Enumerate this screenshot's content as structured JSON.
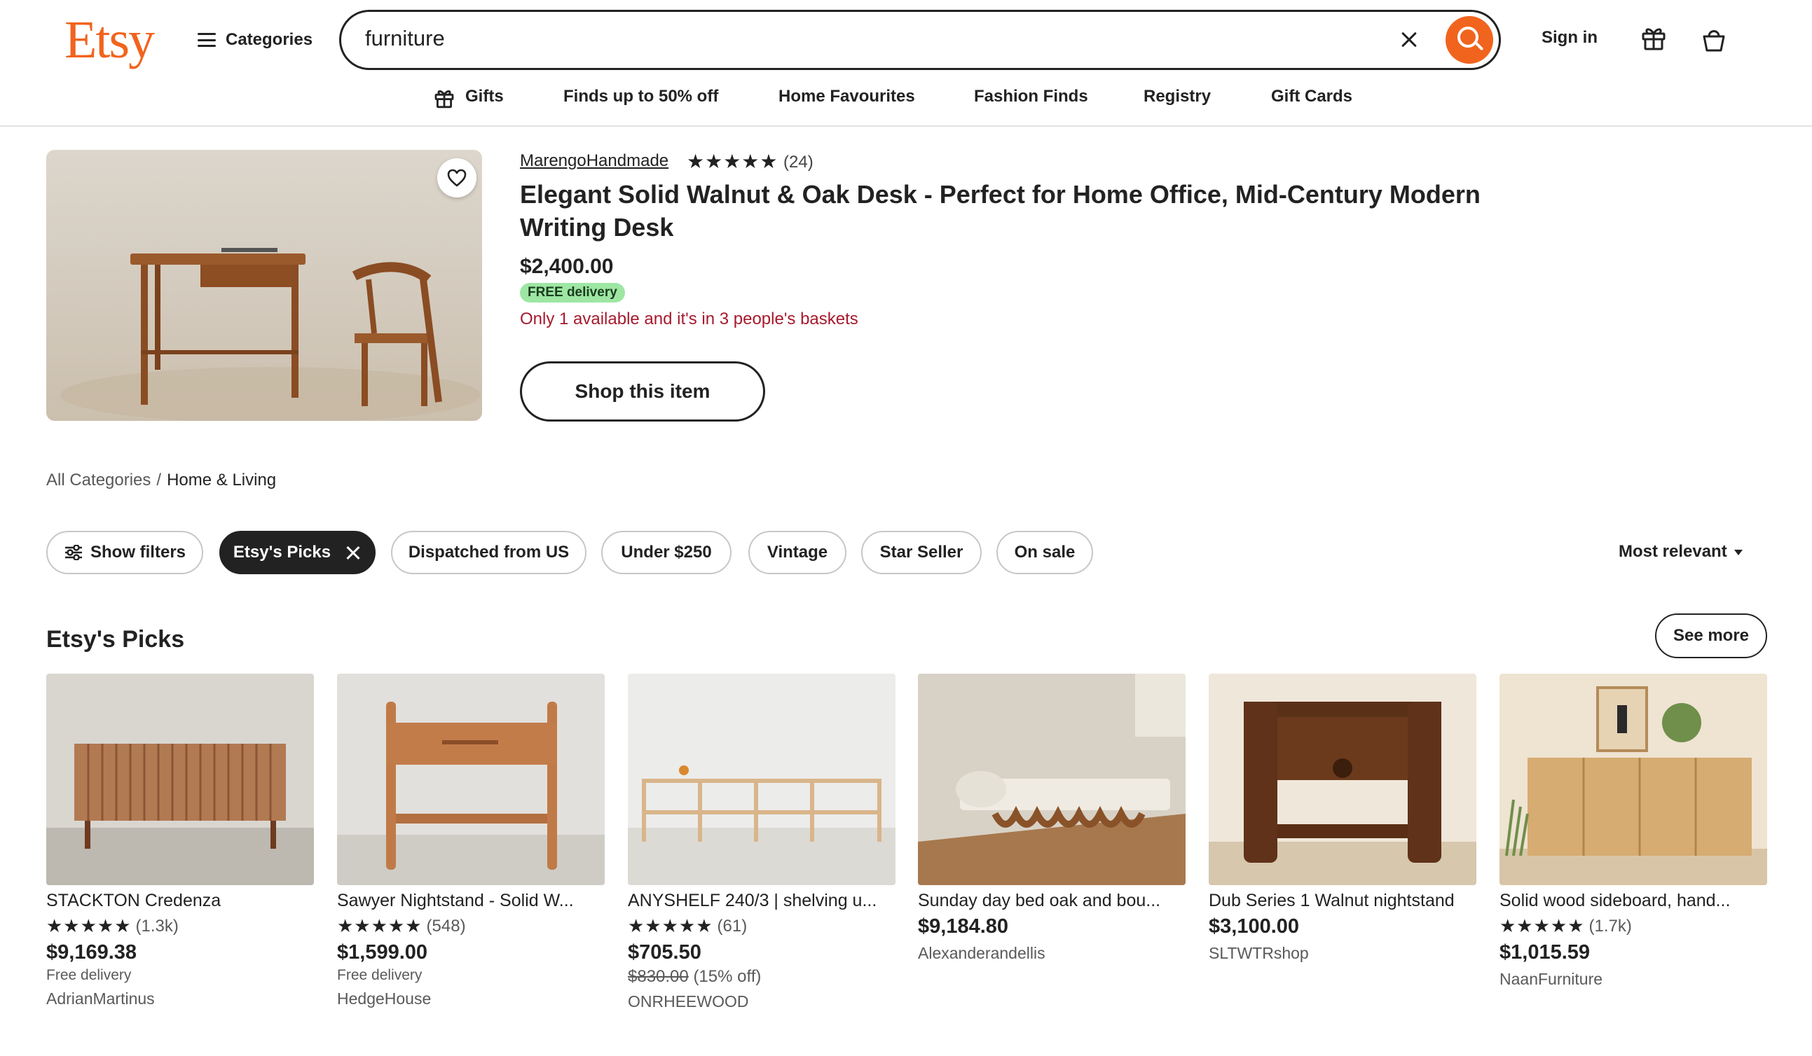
{
  "header": {
    "logo": "Etsy",
    "categories_label": "Categories",
    "search_value": "furniture",
    "signin_label": "Sign in"
  },
  "nav": [
    {
      "label": "Gifts"
    },
    {
      "label": "Finds up to 50% off"
    },
    {
      "label": "Home Favourites"
    },
    {
      "label": "Fashion Finds"
    },
    {
      "label": "Registry"
    },
    {
      "label": "Gift Cards"
    }
  ],
  "featured": {
    "shop": "MarengoHandmade",
    "stars": "★★★★★",
    "review_count": "(24)",
    "title": "Elegant Solid Walnut & Oak Desk - Perfect for Home Office, Mid-Century Modern Writing Desk",
    "price": "$2,400.00",
    "badge": "FREE delivery",
    "availability": "Only 1 available and it's in 3 people's baskets",
    "cta": "Shop this item"
  },
  "breadcrumb": {
    "root": "All Categories",
    "separator": "/",
    "current": "Home & Living"
  },
  "filters": {
    "show_filters": "Show filters",
    "chips": [
      "Etsy's Picks",
      "Dispatched from US",
      "Under $250",
      "Vintage",
      "Star Seller",
      "On sale"
    ],
    "sort": "Most relevant"
  },
  "picks": {
    "title": "Etsy's Picks",
    "see_more": "See more",
    "items": [
      {
        "title": "STACKTON Credenza",
        "stars": "★★★★★",
        "reviews": "(1.3k)",
        "price": "$9,169.38",
        "original": "",
        "discount": "",
        "delivery": "Free delivery",
        "shop": "AdrianMartinus"
      },
      {
        "title": "Sawyer Nightstand - Solid W...",
        "stars": "★★★★★",
        "reviews": "(548)",
        "price": "$1,599.00",
        "original": "",
        "discount": "",
        "delivery": "Free delivery",
        "shop": "HedgeHouse"
      },
      {
        "title": "ANYSHELF 240/3 | shelving u...",
        "stars": "★★★★★",
        "reviews": "(61)",
        "price": "$705.50",
        "original": "$830.00",
        "discount": "(15% off)",
        "delivery": "",
        "shop": "ONRHEEWOOD"
      },
      {
        "title": "Sunday day bed oak and bou...",
        "stars": "",
        "reviews": "",
        "price": "$9,184.80",
        "original": "",
        "discount": "",
        "delivery": "",
        "shop": "Alexanderandellis"
      },
      {
        "title": "Dub Series 1 Walnut nightstand",
        "stars": "",
        "reviews": "",
        "price": "$3,100.00",
        "original": "",
        "discount": "",
        "delivery": "",
        "shop": "SLTWTRshop"
      },
      {
        "title": "Solid wood sideboard, hand...",
        "stars": "★★★★★",
        "reviews": "(1.7k)",
        "price": "$1,015.59",
        "original": "",
        "discount": "",
        "delivery": "",
        "shop": "NaanFurniture"
      }
    ]
  },
  "colors": {
    "brand": "#F1641E",
    "badge_green": "#9ee6a3",
    "alert_red": "#a61a2e",
    "text": "#222222"
  }
}
